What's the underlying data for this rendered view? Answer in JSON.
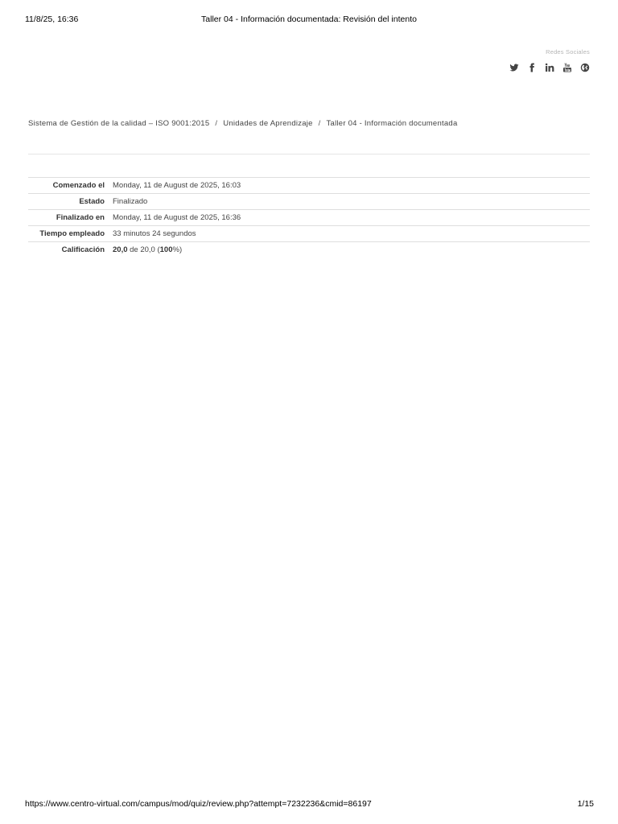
{
  "print_header": {
    "datetime": "11/8/25, 16:36",
    "title": "Taller 04 - Información documentada: Revisión del intento"
  },
  "social": {
    "label": "Redes Sociales",
    "icons": [
      "twitter-icon",
      "facebook-icon",
      "linkedin-icon",
      "youtube-icon",
      "globe-icon"
    ]
  },
  "breadcrumb": {
    "items": [
      "Sistema de Gestión de la calidad – ISO 9001:2015",
      "Unidades de Aprendizaje",
      "Taller 04 - Información documentada"
    ],
    "separator": "/"
  },
  "summary": {
    "started_label": "Comenzado el",
    "started_value": "Monday, 11 de August de 2025, 16:03",
    "state_label": "Estado",
    "state_value": "Finalizado",
    "finished_label": "Finalizado en",
    "finished_value": "Monday, 11 de August de 2025, 16:36",
    "time_label": "Tiempo empleado",
    "time_value": "33 minutos 24 segundos",
    "grade_label": "Calificación",
    "grade_score": "20,0",
    "grade_of": " de 20,0 (",
    "grade_percent": "100",
    "grade_tail": "%)"
  },
  "print_footer": {
    "url": "https://www.centro-virtual.com/campus/mod/quiz/review.php?attempt=7232236&cmid=86197",
    "page": "1/15"
  }
}
